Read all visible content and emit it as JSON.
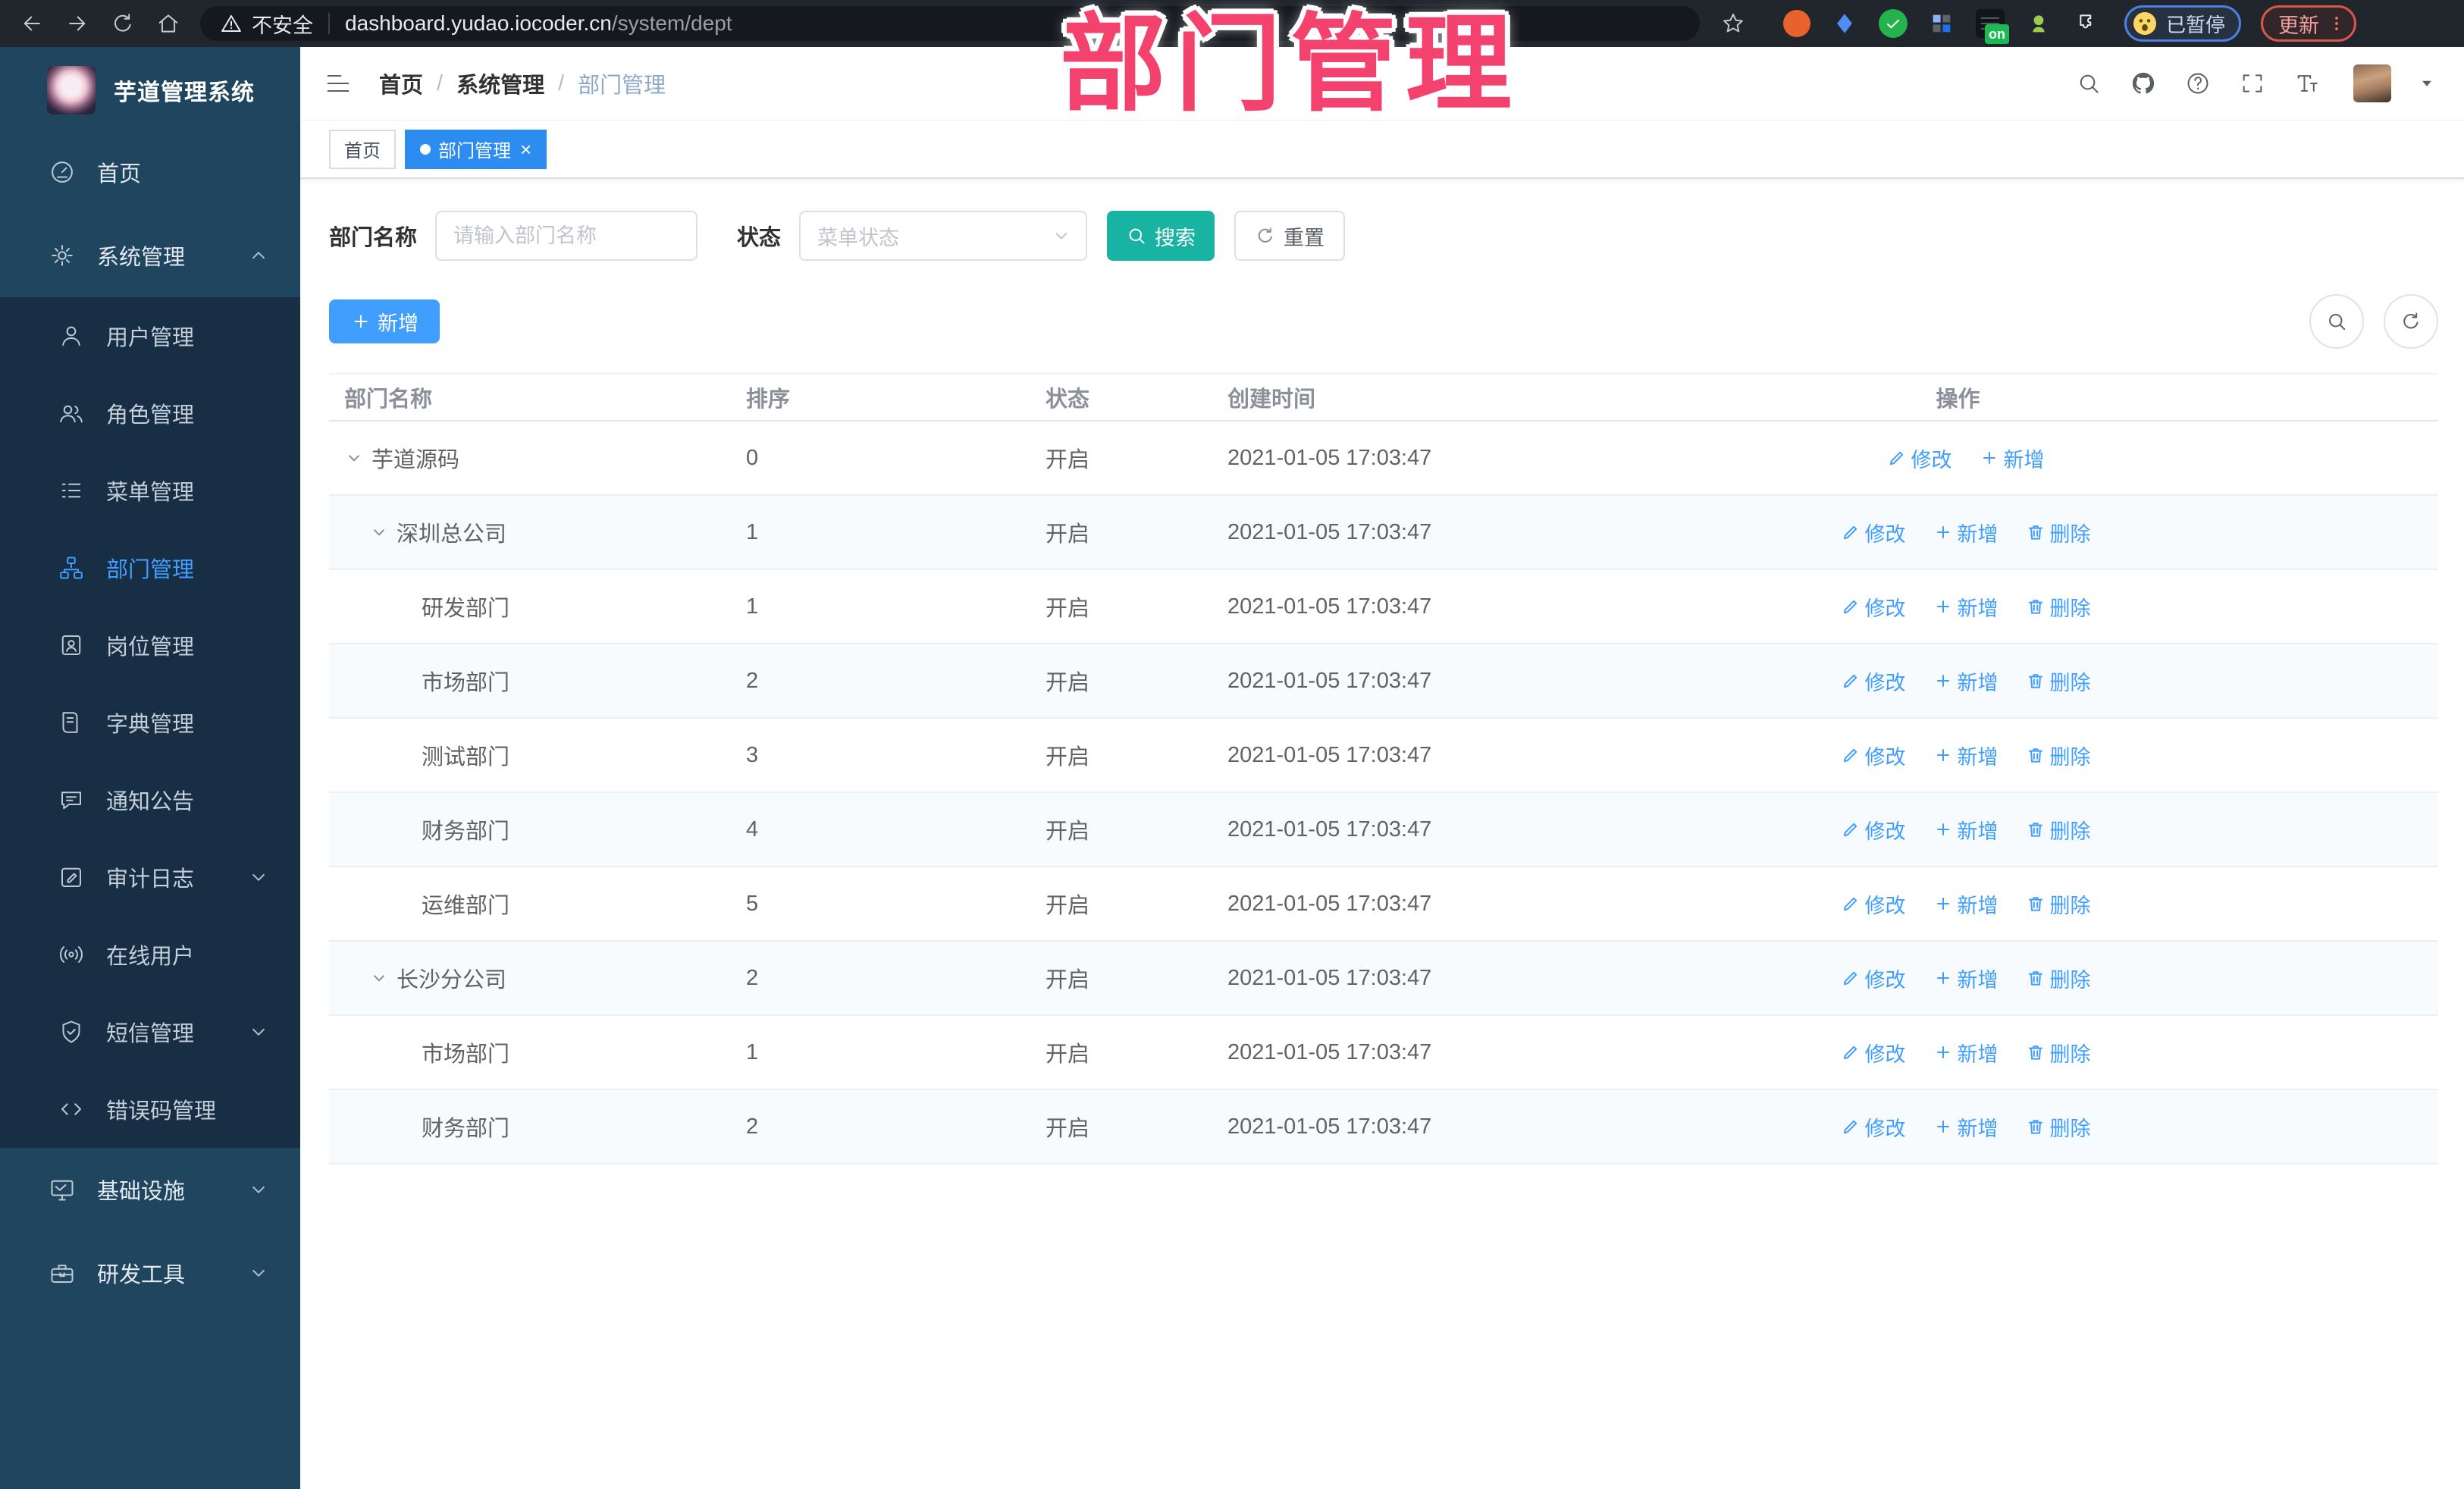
{
  "watermark": "部门管理",
  "colors": {
    "accent": "#409eff",
    "tab_active": "#2d8cf0",
    "search_button": "#18b3a3",
    "watermark": "#f4426e",
    "sidebar": "#1f455f",
    "submenu": "#182e44"
  },
  "browser": {
    "security_label": "不安全",
    "url_domain": "dashboard.yudao.iocoder.cn",
    "url_path": "/system/dept",
    "extensions": [
      {
        "key": "adblock"
      },
      {
        "key": "location-pin"
      },
      {
        "key": "v-green"
      },
      {
        "key": "grid"
      },
      {
        "key": "list-dark",
        "badge": "on"
      },
      {
        "key": "droid"
      },
      {
        "key": "puzzle"
      }
    ],
    "profile_label": "已暂停",
    "update_label": "更新"
  },
  "sidebar": {
    "logo_title": "芋道管理系统",
    "items": [
      {
        "key": "home",
        "label": "首页",
        "icon": "dashboard",
        "level": "top"
      },
      {
        "key": "system",
        "label": "系统管理",
        "icon": "gear",
        "level": "top",
        "arrow": "up"
      },
      {
        "key": "user",
        "label": "用户管理",
        "icon": "user",
        "level": "sub"
      },
      {
        "key": "role",
        "label": "角色管理",
        "icon": "users",
        "level": "sub"
      },
      {
        "key": "menu",
        "label": "菜单管理",
        "icon": "menu-list",
        "level": "sub"
      },
      {
        "key": "dept",
        "label": "部门管理",
        "icon": "org-tree",
        "level": "sub",
        "active": true
      },
      {
        "key": "post",
        "label": "岗位管理",
        "icon": "id-badge",
        "level": "sub"
      },
      {
        "key": "dict",
        "label": "字典管理",
        "icon": "book",
        "level": "sub"
      },
      {
        "key": "notice",
        "label": "通知公告",
        "icon": "megaphone",
        "level": "sub"
      },
      {
        "key": "audit-log",
        "label": "审计日志",
        "icon": "edit-square",
        "level": "sub",
        "arrow": "down"
      },
      {
        "key": "online-user",
        "label": "在线用户",
        "icon": "online",
        "level": "sub"
      },
      {
        "key": "sms",
        "label": "短信管理",
        "icon": "badge-check",
        "level": "sub",
        "arrow": "down"
      },
      {
        "key": "error-code",
        "label": "错误码管理",
        "icon": "code",
        "level": "sub"
      },
      {
        "key": "infra",
        "label": "基础设施",
        "icon": "monitor",
        "level": "top",
        "arrow": "down"
      },
      {
        "key": "dev-tools",
        "label": "研发工具",
        "icon": "toolbox",
        "level": "top",
        "arrow": "down"
      }
    ]
  },
  "navbar": {
    "breadcrumb": [
      "首页",
      "系统管理",
      "部门管理"
    ],
    "separator": "/"
  },
  "tabs": [
    {
      "label": "首页",
      "active": false
    },
    {
      "label": "部门管理",
      "active": true,
      "closable": true
    }
  ],
  "filters": {
    "name_label": "部门名称",
    "name_placeholder": "请输入部门名称",
    "status_label": "状态",
    "status_placeholder": "菜单状态",
    "search_label": "搜索",
    "reset_label": "重置"
  },
  "toolbar": {
    "add_label": "新增"
  },
  "table": {
    "columns": [
      "部门名称",
      "排序",
      "状态",
      "创建时间",
      "操作"
    ],
    "rows": [
      {
        "name": "芋道源码",
        "level": 0,
        "expandable": true,
        "sort": "0",
        "status": "开启",
        "created": "2021-01-05 17:03:47",
        "actions": [
          {
            "label": "修改",
            "icon": "pen"
          },
          {
            "label": "新增",
            "icon": "plus"
          }
        ]
      },
      {
        "name": "深圳总公司",
        "level": 1,
        "expandable": true,
        "sort": "1",
        "status": "开启",
        "created": "2021-01-05 17:03:47",
        "actions": [
          {
            "label": "修改",
            "icon": "pen"
          },
          {
            "label": "新增",
            "icon": "plus"
          },
          {
            "label": "删除",
            "icon": "trash"
          }
        ]
      },
      {
        "name": "研发部门",
        "level": 2,
        "expandable": false,
        "sort": "1",
        "status": "开启",
        "created": "2021-01-05 17:03:47",
        "actions": [
          {
            "label": "修改",
            "icon": "pen"
          },
          {
            "label": "新增",
            "icon": "plus"
          },
          {
            "label": "删除",
            "icon": "trash"
          }
        ]
      },
      {
        "name": "市场部门",
        "level": 2,
        "expandable": false,
        "sort": "2",
        "status": "开启",
        "created": "2021-01-05 17:03:47",
        "actions": [
          {
            "label": "修改",
            "icon": "pen"
          },
          {
            "label": "新增",
            "icon": "plus"
          },
          {
            "label": "删除",
            "icon": "trash"
          }
        ]
      },
      {
        "name": "测试部门",
        "level": 2,
        "expandable": false,
        "sort": "3",
        "status": "开启",
        "created": "2021-01-05 17:03:47",
        "actions": [
          {
            "label": "修改",
            "icon": "pen"
          },
          {
            "label": "新增",
            "icon": "plus"
          },
          {
            "label": "删除",
            "icon": "trash"
          }
        ]
      },
      {
        "name": "财务部门",
        "level": 2,
        "expandable": false,
        "sort": "4",
        "status": "开启",
        "created": "2021-01-05 17:03:47",
        "actions": [
          {
            "label": "修改",
            "icon": "pen"
          },
          {
            "label": "新增",
            "icon": "plus"
          },
          {
            "label": "删除",
            "icon": "trash"
          }
        ]
      },
      {
        "name": "运维部门",
        "level": 2,
        "expandable": false,
        "sort": "5",
        "status": "开启",
        "created": "2021-01-05 17:03:47",
        "actions": [
          {
            "label": "修改",
            "icon": "pen"
          },
          {
            "label": "新增",
            "icon": "plus"
          },
          {
            "label": "删除",
            "icon": "trash"
          }
        ]
      },
      {
        "name": "长沙分公司",
        "level": 1,
        "expandable": true,
        "sort": "2",
        "status": "开启",
        "created": "2021-01-05 17:03:47",
        "actions": [
          {
            "label": "修改",
            "icon": "pen"
          },
          {
            "label": "新增",
            "icon": "plus"
          },
          {
            "label": "删除",
            "icon": "trash"
          }
        ]
      },
      {
        "name": "市场部门",
        "level": 2,
        "expandable": false,
        "sort": "1",
        "status": "开启",
        "created": "2021-01-05 17:03:47",
        "actions": [
          {
            "label": "修改",
            "icon": "pen"
          },
          {
            "label": "新增",
            "icon": "plus"
          },
          {
            "label": "删除",
            "icon": "trash"
          }
        ]
      },
      {
        "name": "财务部门",
        "level": 2,
        "expandable": false,
        "sort": "2",
        "status": "开启",
        "created": "2021-01-05 17:03:47",
        "actions": [
          {
            "label": "修改",
            "icon": "pen"
          },
          {
            "label": "新增",
            "icon": "plus"
          },
          {
            "label": "删除",
            "icon": "trash"
          }
        ]
      }
    ]
  }
}
